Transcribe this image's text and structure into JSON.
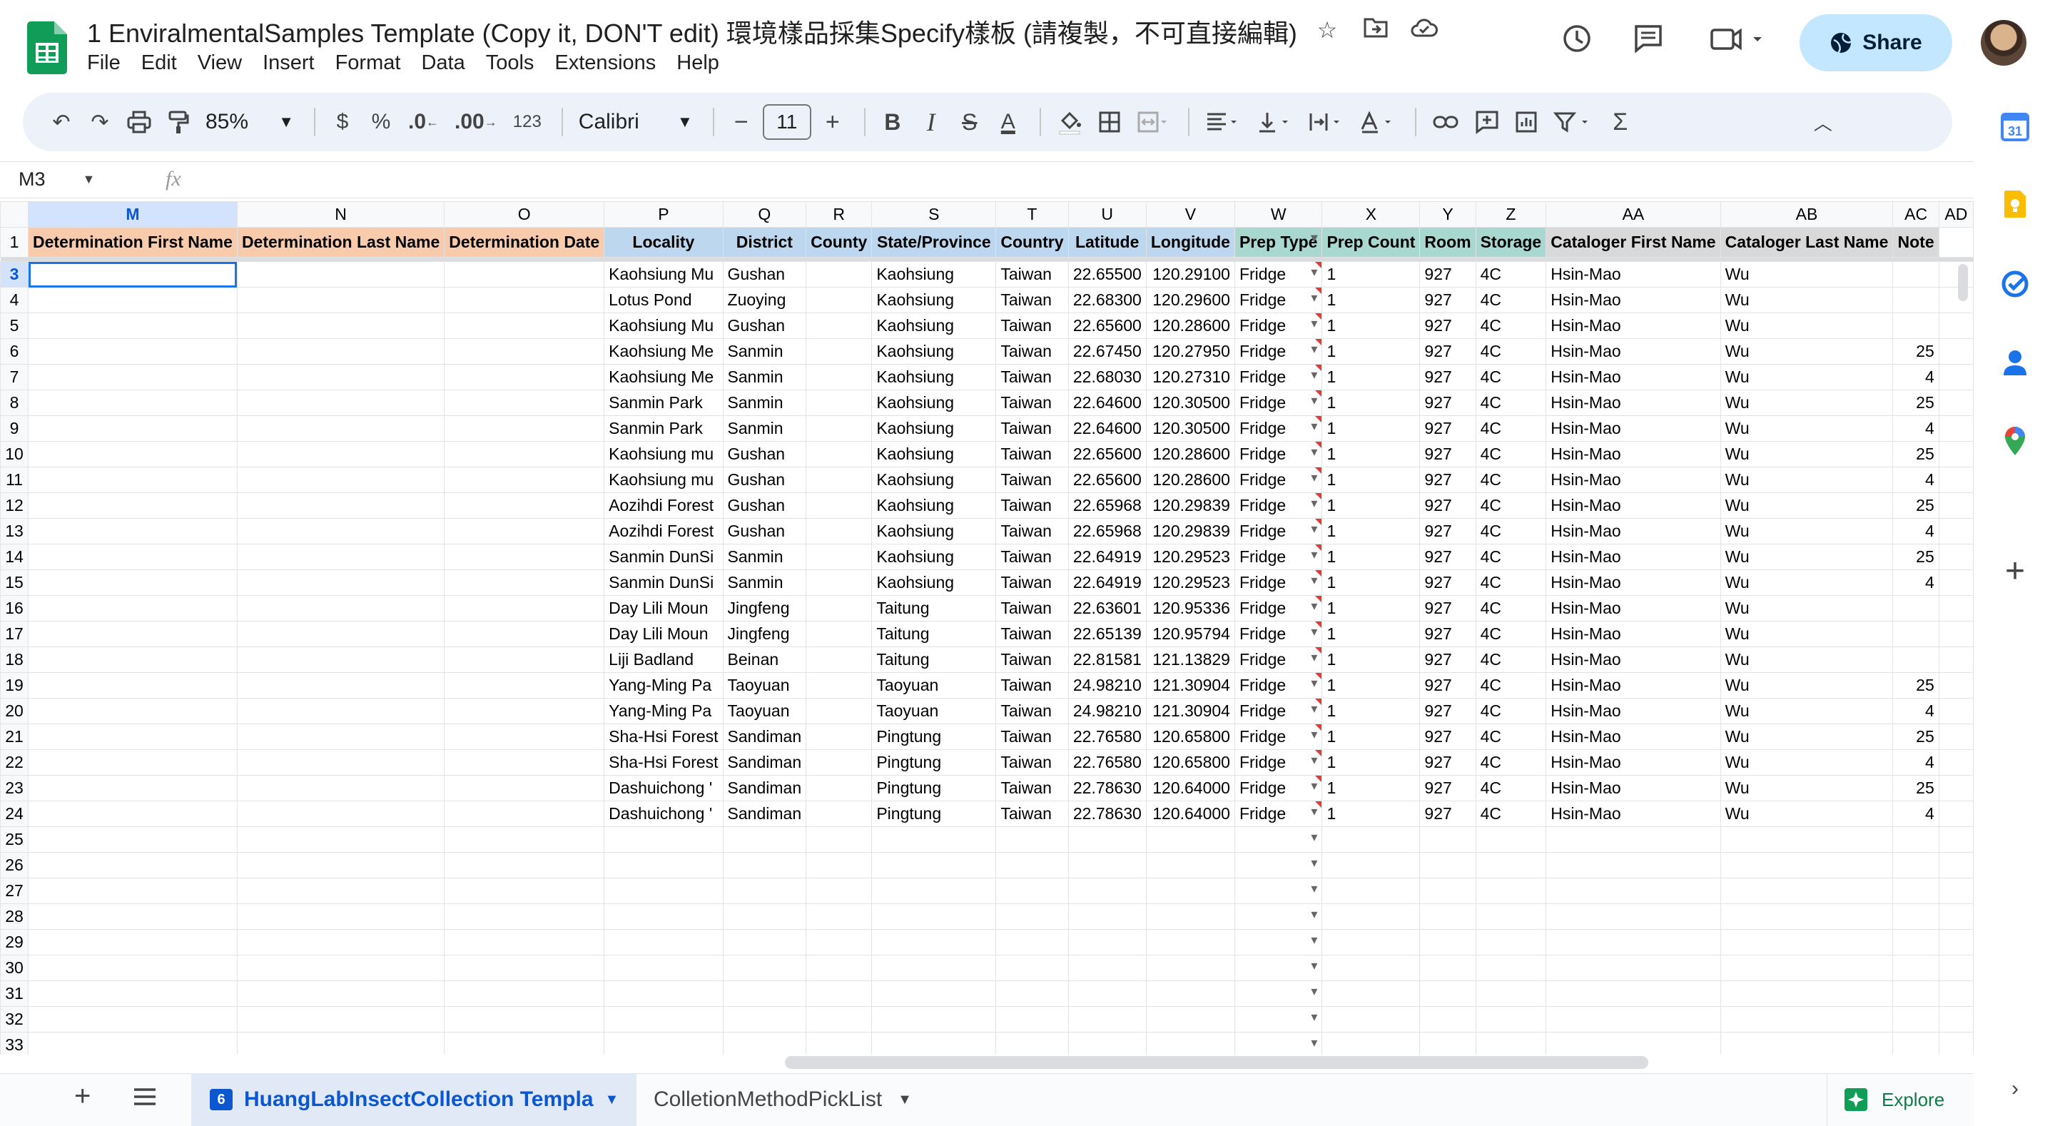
{
  "app": {
    "title": "1 EnviralmentalSamples Template (Copy it, DON'T edit) 環境樣品採集Specify樣板 (請複製，不可直接編輯)",
    "menu": [
      "File",
      "Edit",
      "View",
      "Insert",
      "Format",
      "Data",
      "Tools",
      "Extensions",
      "Help"
    ],
    "share_label": "Share"
  },
  "toolbar": {
    "zoom": "85%",
    "currency": "$",
    "percent": "%",
    "dec_decrease": ".0",
    "dec_increase": ".00",
    "number_format": "123",
    "font": "Calibri",
    "font_size": "11",
    "bold": "B",
    "italic": "I",
    "strike": "S",
    "text_color": "A",
    "text_color_hex": "#000000",
    "fill_color_hex": "#ffffff"
  },
  "formula_bar": {
    "cell_ref": "M3",
    "fx": "fx",
    "value": ""
  },
  "colors": {
    "accent": "#0b57d0",
    "header_orange": "#f8cbad",
    "header_blue": "#bdd7ee",
    "header_teal": "#a9d8d0",
    "header_gray": "#d9d9d9",
    "share_bg": "#c2e7ff"
  },
  "columns": [
    "M",
    "N",
    "O",
    "P",
    "Q",
    "R",
    "S",
    "T",
    "U",
    "V",
    "W",
    "X",
    "Y",
    "Z",
    "AA",
    "AB",
    "AC",
    "AD"
  ],
  "header_row": {
    "row_number": "1",
    "cells": [
      "Determination First Name",
      "Determination Last Name",
      "Determination Date",
      "Locality",
      "District",
      "County",
      "State/Province",
      "Country",
      "Latitude",
      "Longitude",
      "Prep Type",
      "Prep Count",
      "Room",
      "Storage",
      "Cataloger First Name",
      "Cataloger Last Name",
      "Note",
      ""
    ]
  },
  "rows": [
    {
      "n": "3",
      "cells": [
        "",
        "",
        "",
        "Kaohsiung Mu",
        "Gushan",
        "",
        "Kaohsiung",
        "Taiwan",
        "22.65500",
        "120.29100",
        "Fridge",
        "1",
        "927",
        "4C",
        "Hsin-Mao",
        "Wu",
        "",
        ""
      ]
    },
    {
      "n": "4",
      "cells": [
        "",
        "",
        "",
        "Lotus Pond",
        "Zuoying",
        "",
        "Kaohsiung",
        "Taiwan",
        "22.68300",
        "120.29600",
        "Fridge",
        "1",
        "927",
        "4C",
        "Hsin-Mao",
        "Wu",
        "",
        ""
      ]
    },
    {
      "n": "5",
      "cells": [
        "",
        "",
        "",
        "Kaohsiung Mu",
        "Gushan",
        "",
        "Kaohsiung",
        "Taiwan",
        "22.65600",
        "120.28600",
        "Fridge",
        "1",
        "927",
        "4C",
        "Hsin-Mao",
        "Wu",
        "",
        ""
      ]
    },
    {
      "n": "6",
      "cells": [
        "",
        "",
        "",
        "Kaohsiung Me",
        "Sanmin",
        "",
        "Kaohsiung",
        "Taiwan",
        "22.67450",
        "120.27950",
        "Fridge",
        "1",
        "927",
        "4C",
        "Hsin-Mao",
        "Wu",
        "25",
        ""
      ]
    },
    {
      "n": "7",
      "cells": [
        "",
        "",
        "",
        "Kaohsiung Me",
        "Sanmin",
        "",
        "Kaohsiung",
        "Taiwan",
        "22.68030",
        "120.27310",
        "Fridge",
        "1",
        "927",
        "4C",
        "Hsin-Mao",
        "Wu",
        "4",
        ""
      ]
    },
    {
      "n": "8",
      "cells": [
        "",
        "",
        "",
        "Sanmin Park",
        "Sanmin",
        "",
        "Kaohsiung",
        "Taiwan",
        "22.64600",
        "120.30500",
        "Fridge",
        "1",
        "927",
        "4C",
        "Hsin-Mao",
        "Wu",
        "25",
        ""
      ]
    },
    {
      "n": "9",
      "cells": [
        "",
        "",
        "",
        "Sanmin Park",
        "Sanmin",
        "",
        "Kaohsiung",
        "Taiwan",
        "22.64600",
        "120.30500",
        "Fridge",
        "1",
        "927",
        "4C",
        "Hsin-Mao",
        "Wu",
        "4",
        ""
      ]
    },
    {
      "n": "10",
      "cells": [
        "",
        "",
        "",
        "Kaohsiung mu",
        "Gushan",
        "",
        "Kaohsiung",
        "Taiwan",
        "22.65600",
        "120.28600",
        "Fridge",
        "1",
        "927",
        "4C",
        "Hsin-Mao",
        "Wu",
        "25",
        ""
      ]
    },
    {
      "n": "11",
      "cells": [
        "",
        "",
        "",
        "Kaohsiung mu",
        "Gushan",
        "",
        "Kaohsiung",
        "Taiwan",
        "22.65600",
        "120.28600",
        "Fridge",
        "1",
        "927",
        "4C",
        "Hsin-Mao",
        "Wu",
        "4",
        ""
      ]
    },
    {
      "n": "12",
      "cells": [
        "",
        "",
        "",
        "Aozihdi Forest",
        "Gushan",
        "",
        "Kaohsiung",
        "Taiwan",
        "22.65968",
        "120.29839",
        "Fridge",
        "1",
        "927",
        "4C",
        "Hsin-Mao",
        "Wu",
        "25",
        ""
      ]
    },
    {
      "n": "13",
      "cells": [
        "",
        "",
        "",
        "Aozihdi Forest",
        "Gushan",
        "",
        "Kaohsiung",
        "Taiwan",
        "22.65968",
        "120.29839",
        "Fridge",
        "1",
        "927",
        "4C",
        "Hsin-Mao",
        "Wu",
        "4",
        ""
      ]
    },
    {
      "n": "14",
      "cells": [
        "",
        "",
        "",
        "Sanmin DunSi",
        "Sanmin",
        "",
        "Kaohsiung",
        "Taiwan",
        "22.64919",
        "120.29523",
        "Fridge",
        "1",
        "927",
        "4C",
        "Hsin-Mao",
        "Wu",
        "25",
        ""
      ]
    },
    {
      "n": "15",
      "cells": [
        "",
        "",
        "",
        "Sanmin DunSi",
        "Sanmin",
        "",
        "Kaohsiung",
        "Taiwan",
        "22.64919",
        "120.29523",
        "Fridge",
        "1",
        "927",
        "4C",
        "Hsin-Mao",
        "Wu",
        "4",
        ""
      ]
    },
    {
      "n": "16",
      "cells": [
        "",
        "",
        "",
        "Day Lili Moun",
        "Jingfeng",
        "",
        "Taitung",
        "Taiwan",
        "22.63601",
        "120.95336",
        "Fridge",
        "1",
        "927",
        "4C",
        "Hsin-Mao",
        "Wu",
        "",
        ""
      ]
    },
    {
      "n": "17",
      "cells": [
        "",
        "",
        "",
        "Day Lili Moun",
        "Jingfeng",
        "",
        "Taitung",
        "Taiwan",
        "22.65139",
        "120.95794",
        "Fridge",
        "1",
        "927",
        "4C",
        "Hsin-Mao",
        "Wu",
        "",
        ""
      ]
    },
    {
      "n": "18",
      "cells": [
        "",
        "",
        "",
        "Liji Badland",
        "Beinan",
        "",
        "Taitung",
        "Taiwan",
        "22.81581",
        "121.13829",
        "Fridge",
        "1",
        "927",
        "4C",
        "Hsin-Mao",
        "Wu",
        "",
        ""
      ]
    },
    {
      "n": "19",
      "cells": [
        "",
        "",
        "",
        "Yang-Ming Pa",
        "Taoyuan",
        "",
        "Taoyuan",
        "Taiwan",
        "24.98210",
        "121.30904",
        "Fridge",
        "1",
        "927",
        "4C",
        "Hsin-Mao",
        "Wu",
        "25",
        ""
      ]
    },
    {
      "n": "20",
      "cells": [
        "",
        "",
        "",
        "Yang-Ming Pa",
        "Taoyuan",
        "",
        "Taoyuan",
        "Taiwan",
        "24.98210",
        "121.30904",
        "Fridge",
        "1",
        "927",
        "4C",
        "Hsin-Mao",
        "Wu",
        "4",
        ""
      ]
    },
    {
      "n": "21",
      "cells": [
        "",
        "",
        "",
        "Sha-Hsi Forest",
        "Sandiman",
        "",
        "Pingtung",
        "Taiwan",
        "22.76580",
        "120.65800",
        "Fridge",
        "1",
        "927",
        "4C",
        "Hsin-Mao",
        "Wu",
        "25",
        ""
      ]
    },
    {
      "n": "22",
      "cells": [
        "",
        "",
        "",
        "Sha-Hsi Forest",
        "Sandiman",
        "",
        "Pingtung",
        "Taiwan",
        "22.76580",
        "120.65800",
        "Fridge",
        "1",
        "927",
        "4C",
        "Hsin-Mao",
        "Wu",
        "4",
        ""
      ]
    },
    {
      "n": "23",
      "cells": [
        "",
        "",
        "",
        "Dashuichong '",
        "Sandiman",
        "",
        "Pingtung",
        "Taiwan",
        "22.78630",
        "120.64000",
        "Fridge",
        "1",
        "927",
        "4C",
        "Hsin-Mao",
        "Wu",
        "25",
        ""
      ]
    },
    {
      "n": "24",
      "cells": [
        "",
        "",
        "",
        "Dashuichong '",
        "Sandiman",
        "",
        "Pingtung",
        "Taiwan",
        "22.78630",
        "120.64000",
        "Fridge",
        "1",
        "927",
        "4C",
        "Hsin-Mao",
        "Wu",
        "4",
        ""
      ]
    }
  ],
  "empty_rows": [
    "25",
    "26",
    "27",
    "28",
    "29",
    "30",
    "31",
    "32",
    "33"
  ],
  "sheets": {
    "active": {
      "label": "HuangLabInsectCollection Templa",
      "badge": "6"
    },
    "other": {
      "label": "ColletionMethodPickList"
    }
  },
  "explore_label": "Explore",
  "icons": {
    "star": "star-icon",
    "move": "folder-move-icon",
    "cloud": "cloud-saved-icon",
    "history": "history-icon",
    "comments": "comment-icon",
    "meet": "video-call-icon",
    "share_globe": "globe-icon"
  }
}
